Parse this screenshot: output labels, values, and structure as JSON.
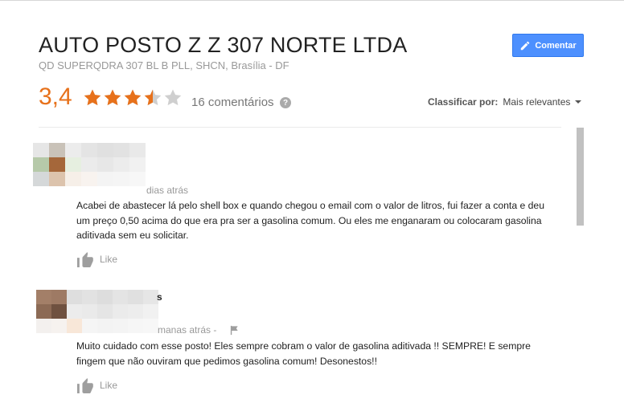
{
  "business": {
    "name": "AUTO POSTO Z Z 307 NORTE LTDA",
    "address": "QD SUPERQDRA 307 BL B PLL, SHCN, Brasília - DF"
  },
  "toolbar": {
    "comment_label": "Comentar"
  },
  "rating": {
    "value_text": "3,4",
    "value": 3.4,
    "max": 5,
    "count_text": "16 comentários"
  },
  "sort": {
    "label": "Classificar por:",
    "value": "Mais relevantes"
  },
  "colors": {
    "accent": "#e7711b",
    "button": "#4d90fe",
    "muted": "#999999"
  },
  "reviews": [
    {
      "time": "dias atrás",
      "text": "Acabei de abastecer lá pelo shell box e quando chegou o email com o valor de litros, fui fazer a conta e deu um preço 0,50 acima do que era pra ser a gasolina comum. Ou eles me enganaram ou colocaram gasolina aditivada sem eu solicitar.",
      "like_label": "Like"
    },
    {
      "name_fragment": "s",
      "time": "manas atrás -",
      "text": "Muito cuidado com esse posto! Eles sempre cobram o valor de gasolina aditivada !! SEMPRE! E sempre fingem que não ouviram que pedimos gasolina comum! Desonestos!!",
      "like_label": "Like"
    }
  ]
}
